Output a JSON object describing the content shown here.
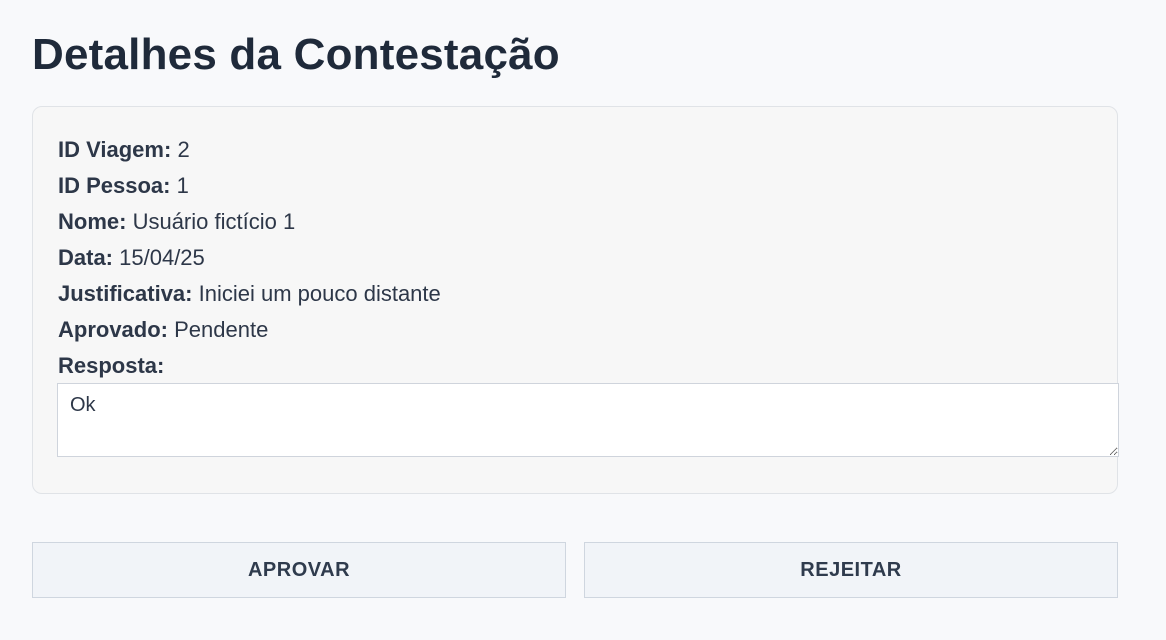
{
  "page": {
    "title": "Detalhes da Contestação"
  },
  "details": {
    "trip_id_label": "ID Viagem:",
    "trip_id_value": "2",
    "person_id_label": "ID Pessoa:",
    "person_id_value": "1",
    "name_label": "Nome:",
    "name_value": "Usuário fictício 1",
    "date_label": "Data:",
    "date_value": "15/04/25",
    "justification_label": "Justificativa:",
    "justification_value": "Iniciei um pouco distante",
    "approved_label": "Aprovado:",
    "approved_value": "Pendente",
    "response_label": "Resposta:",
    "response_value": "Ok"
  },
  "actions": {
    "approve_label": "APROVAR",
    "reject_label": "REJEITAR"
  }
}
